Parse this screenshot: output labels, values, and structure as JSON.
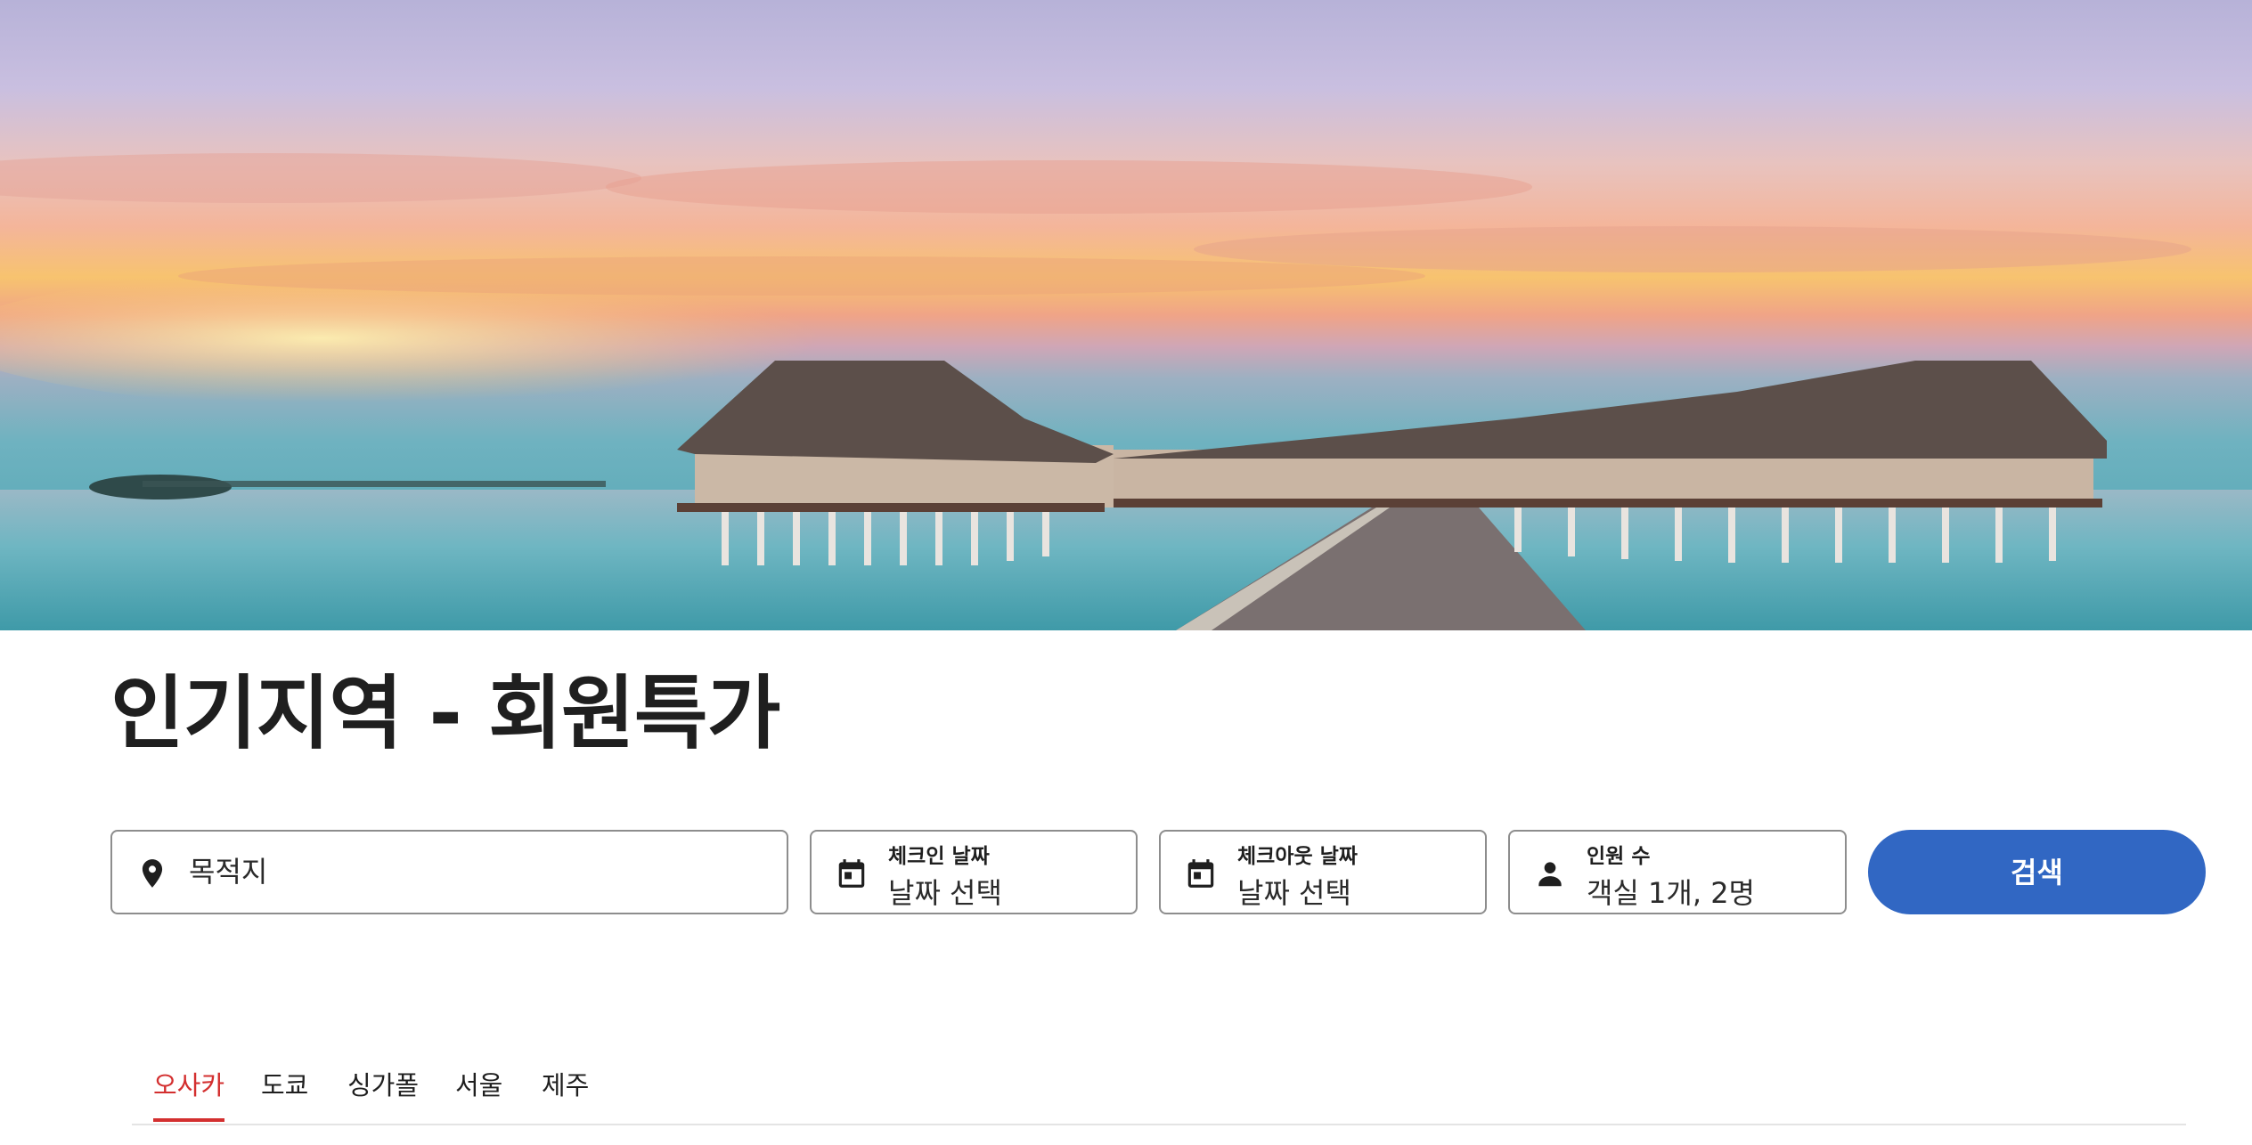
{
  "hero": {
    "image": "overwater-villas-sunset"
  },
  "page_title": "인기지역 - 회원특가",
  "search": {
    "destination": {
      "icon": "location-pin-icon",
      "placeholder": "목적지"
    },
    "checkin": {
      "icon": "calendar-icon",
      "label": "체크인 날짜",
      "value": "날짜 선택"
    },
    "checkout": {
      "icon": "calendar-icon",
      "label": "체크아웃 날짜",
      "value": "날짜 선택"
    },
    "guests": {
      "icon": "person-icon",
      "label": "인원 수",
      "value": "객실 1개, 2명"
    },
    "button_label": "검색"
  },
  "tabs": [
    {
      "label": "오사카",
      "active": true
    },
    {
      "label": "도쿄",
      "active": false
    },
    {
      "label": "싱가폴",
      "active": false
    },
    {
      "label": "서울",
      "active": false
    },
    {
      "label": "제주",
      "active": false
    }
  ],
  "colors": {
    "accent": "#3167c3",
    "active_tab": "#d32f2f",
    "border": "#8d8d8d"
  }
}
